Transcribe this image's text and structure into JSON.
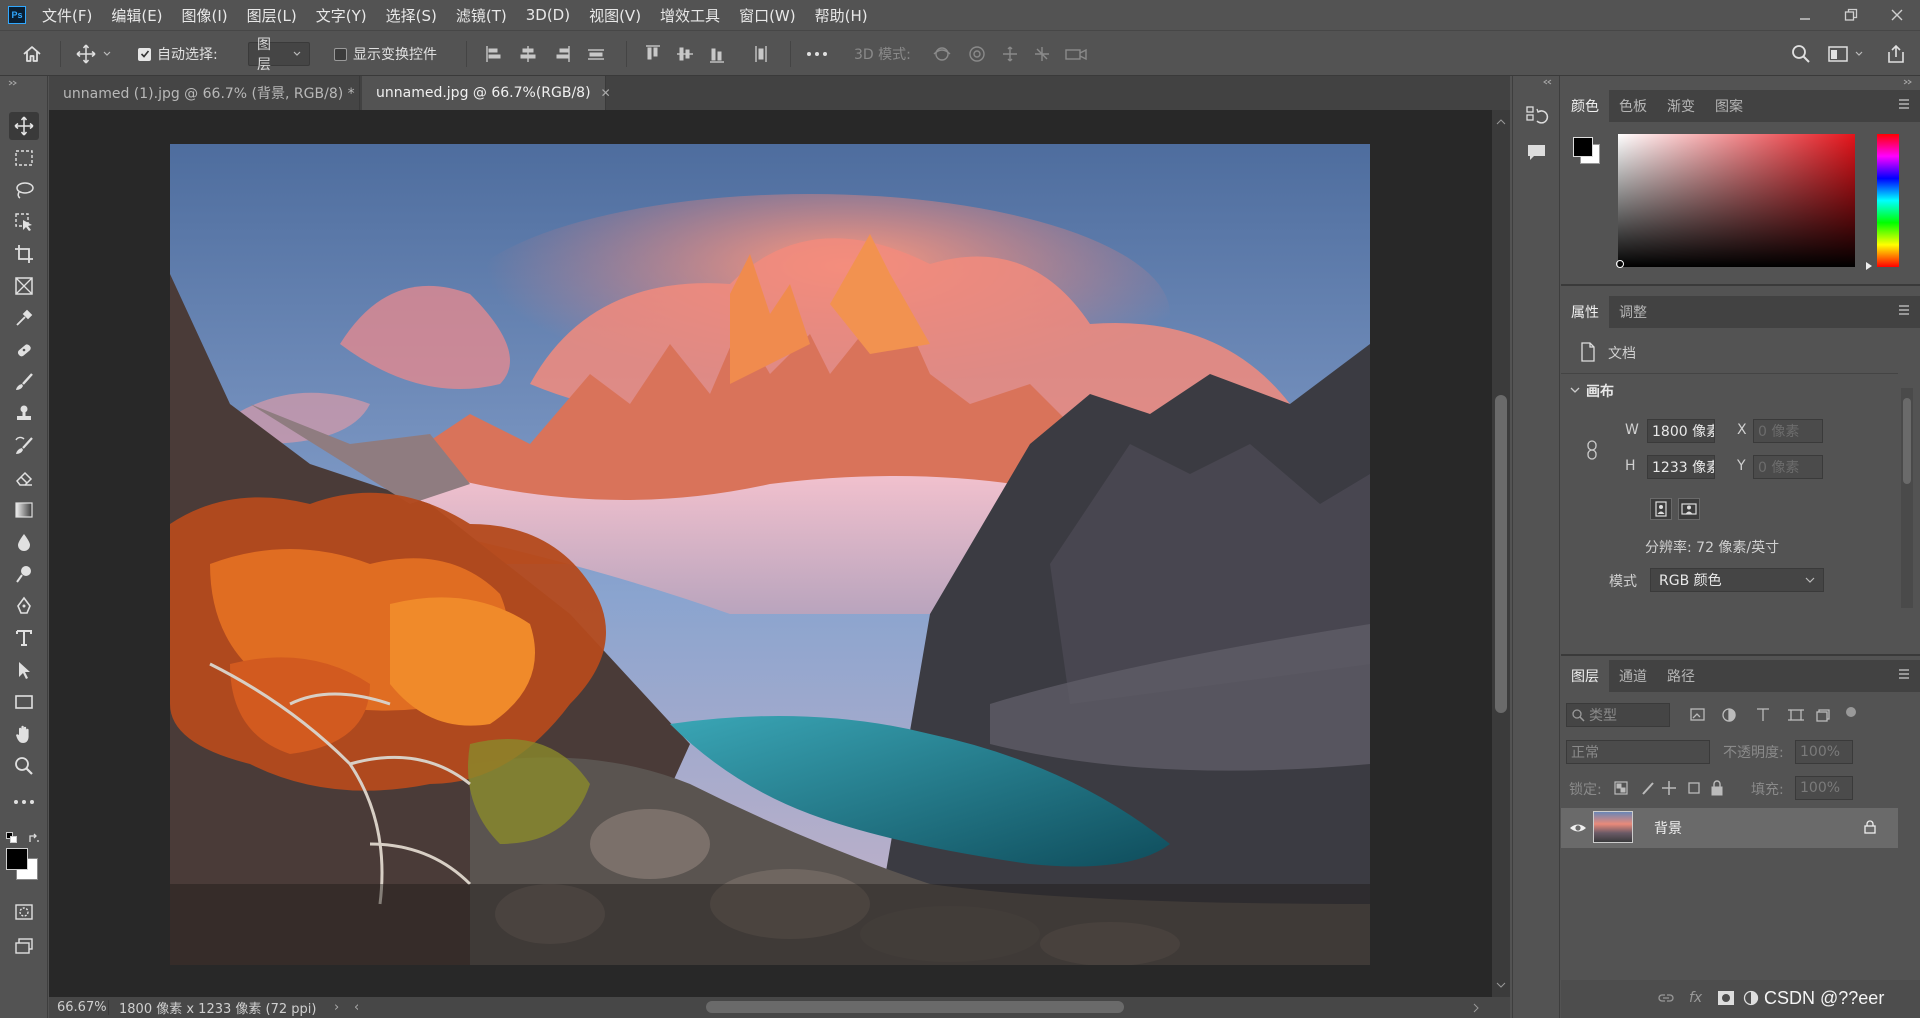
{
  "menu": {
    "logo": "Ps",
    "items": [
      "文件(F)",
      "编辑(E)",
      "图像(I)",
      "图层(L)",
      "文字(Y)",
      "选择(S)",
      "滤镜(T)",
      "3D(D)",
      "视图(V)",
      "增效工具",
      "窗口(W)",
      "帮助(H)"
    ]
  },
  "options": {
    "auto_select_label": "自动选择:",
    "auto_select_target": "图层",
    "show_transform_label": "显示变换控件",
    "mode_3d_label": "3D 模式:"
  },
  "tabs": [
    {
      "title": "unnamed (1).jpg @ 66.7% (背景, RGB/8) *"
    },
    {
      "title": "unnamed.jpg @ 66.7%(RGB/8)"
    }
  ],
  "status": {
    "zoom": "66.67%",
    "doc_info": "1800 像素 x 1233 像素 (72 ppi)"
  },
  "color_panel": {
    "tabs": [
      "颜色",
      "色板",
      "渐变",
      "图案"
    ],
    "foreground": "#000000",
    "background": "#ffffff",
    "hue_color": "#e4141b"
  },
  "properties_panel": {
    "tabs": [
      "属性",
      "调整"
    ],
    "doc_label": "文档",
    "section": "画布",
    "w_label": "W",
    "w_value": "1800 像素",
    "h_label": "H",
    "h_value": "1233 像素",
    "x_label": "X",
    "x_placeholder": "0 像素",
    "y_label": "Y",
    "y_placeholder": "0 像素",
    "resolution": "分辨率: 72 像素/英寸",
    "mode_label": "模式",
    "mode_value": "RGB 颜色"
  },
  "layers_panel": {
    "tabs": [
      "图层",
      "通道",
      "路径"
    ],
    "filter_placeholder": "类型",
    "blend_mode": "正常",
    "opacity_label": "不透明度:",
    "opacity_value": "100%",
    "lock_label": "锁定:",
    "fill_label": "填充:",
    "fill_value": "100%",
    "layers": [
      {
        "name": "背景",
        "visible": true,
        "locked": true
      }
    ]
  },
  "watermark": "CSDN @??eer"
}
